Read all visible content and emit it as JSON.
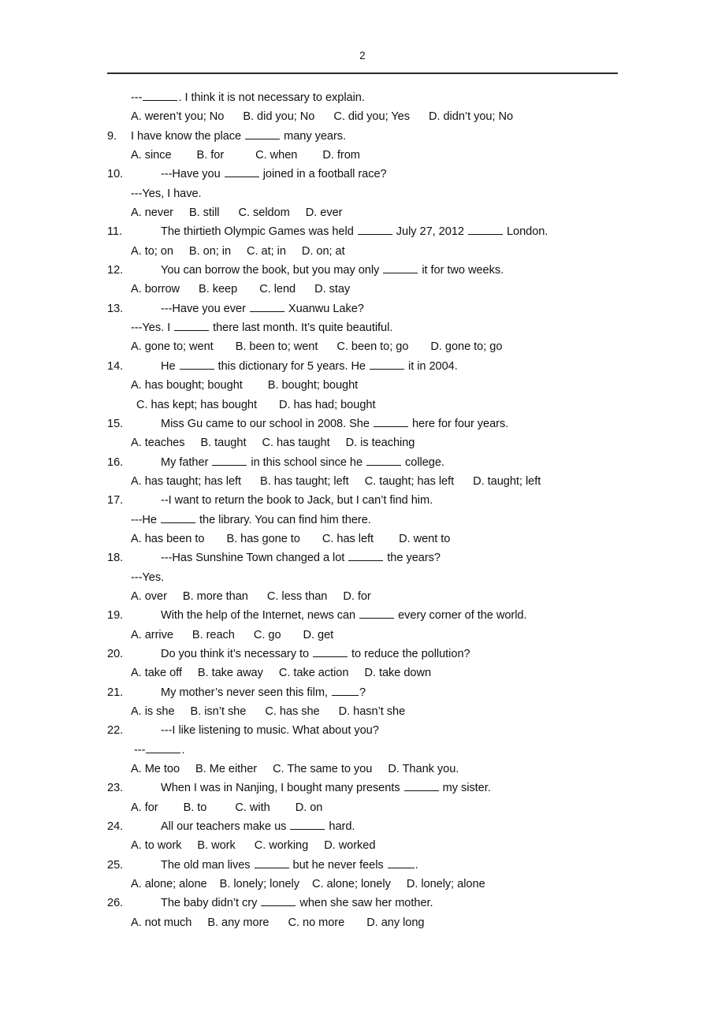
{
  "document": {
    "page_number": "2",
    "type": "english-grammar-multiple-choice-worksheet"
  },
  "questions": [
    {
      "number": "",
      "stem_prefix": "---",
      "blank": "md",
      "stem_suffix": ". I think it is not necessary to explain.",
      "options_lines": [
        "A. weren’t you; No      B. did you; No      C. did you; Yes      D. didn’t you; No"
      ]
    },
    {
      "number": "9.",
      "stem_prefix": "I have know the place ",
      "blank": "md",
      "stem_suffix": " many years.",
      "options_lines": [
        "A. since        B. for          C. when        D. from"
      ]
    },
    {
      "number": "10.",
      "stem_prefix": "---Have you ",
      "blank": "md",
      "stem_suffix": " joined in a football race?",
      "extra_line": "---Yes, I have.",
      "options_lines": [
        "A. never     B. still      C. seldom     D. ever"
      ]
    },
    {
      "number": "11.",
      "stem_prefix": "The thirtieth Olympic Games was held ",
      "blank": "md",
      "stem_mid": " July 27, 2012 ",
      "blank2": "md",
      "stem_suffix": " London.",
      "options_lines": [
        "A. to; on     B. on; in     C. at; in     D. on; at"
      ]
    },
    {
      "number": "12.",
      "stem_prefix": "You can borrow the book, but you may only ",
      "blank": "md",
      "stem_suffix": " it for two weeks.",
      "options_lines": [
        "A. borrow      B. keep       C. lend      D. stay"
      ]
    },
    {
      "number": "13.",
      "stem_prefix": "---Have you ever ",
      "blank": "md",
      "stem_suffix": " Xuanwu Lake?",
      "extra_line_prefix": "---Yes. I ",
      "extra_line_blank": "md",
      "extra_line_suffix": " there last month. It’s quite beautiful.",
      "options_lines": [
        "A. gone to; went       B. been to; went      C. been to; go       D. gone to; go"
      ]
    },
    {
      "number": "14.",
      "stem_prefix": "He ",
      "blank": "md",
      "stem_mid": " this dictionary for 5 years. He ",
      "blank2": "md",
      "stem_suffix": " it in 2004.",
      "options_lines": [
        "A. has bought; bought        B. bought; bought",
        "C. has kept; has bought       D. has had; bought"
      ]
    },
    {
      "number": "15.",
      "stem_prefix": "Miss Gu came to our school in 2008. She ",
      "blank": "md",
      "stem_suffix": " here for four years.",
      "options_lines": [
        "A. teaches     B. taught     C. has taught     D. is teaching"
      ]
    },
    {
      "number": "16.",
      "stem_prefix": "My father ",
      "blank": "md",
      "stem_mid": " in this school since he ",
      "blank2": "md",
      "stem_suffix": " college.",
      "options_lines": [
        "A. has taught; has left      B. has taught; left     C. taught; has left      D. taught; left"
      ]
    },
    {
      "number": "17.",
      "stem_prefix": "--I want to return the book to Jack, but I can’t find him.",
      "extra_line_prefix": "---He ",
      "extra_line_blank": "md",
      "extra_line_suffix": " the library. You can find him there.",
      "options_lines": [
        "A. has been to       B. has gone to       C. has left        D. went to"
      ]
    },
    {
      "number": "18.",
      "stem_prefix": "---Has Sunshine Town changed a lot ",
      "blank": "md",
      "stem_suffix": " the years?",
      "extra_line": "---Yes.",
      "options_lines": [
        "A. over     B. more than      C. less than     D. for"
      ]
    },
    {
      "number": "19.",
      "stem_prefix": "With the help of the Internet, news can ",
      "blank": "md",
      "stem_suffix": " every corner of the world.",
      "options_lines": [
        "A. arrive      B. reach      C. go       D. get"
      ]
    },
    {
      "number": "20.",
      "stem_prefix": "Do you think it’s necessary to ",
      "blank": "md",
      "stem_suffix": " to reduce the pollution?",
      "options_lines": [
        "A. take off     B. take away     C. take action     D. take down"
      ]
    },
    {
      "number": "21.",
      "stem_prefix": "My mother’s never seen this film, ",
      "blank": "sm",
      "stem_suffix": "?",
      "options_lines": [
        "A. is she     B. isn’t she      C. has she      D. hasn’t she"
      ]
    },
    {
      "number": "22.",
      "stem_prefix": "---I like listening to music. What about you?",
      "extra_line_prefix": "---",
      "extra_line_blank": "md",
      "extra_line_suffix": ".",
      "options_lines": [
        "A. Me too     B. Me either     C. The same to you     D. Thank you."
      ]
    },
    {
      "number": "23.",
      "stem_prefix": "When I was in Nanjing, I bought many presents ",
      "blank": "md",
      "stem_suffix": " my sister.",
      "options_lines": [
        "A. for        B. to         C. with        D. on"
      ]
    },
    {
      "number": "24.",
      "stem_prefix": "All our teachers make us ",
      "blank": "md",
      "stem_suffix": " hard.",
      "options_lines": [
        "A. to work     B. work      C. working     D. worked"
      ]
    },
    {
      "number": "25.",
      "stem_prefix": "The old man lives ",
      "blank": "md",
      "stem_mid": " but he never feels ",
      "blank2": "sm",
      "stem_suffix": ".",
      "options_lines": [
        "A. alone; alone    B. lonely; lonely    C. alone; lonely     D. lonely; alone"
      ]
    },
    {
      "number": "26.",
      "stem_prefix": "The baby didn’t cry ",
      "blank": "md",
      "stem_suffix": " when she saw her mother.",
      "options_lines": [
        "A. not much     B. any more      C. no more       D. any long"
      ]
    }
  ]
}
